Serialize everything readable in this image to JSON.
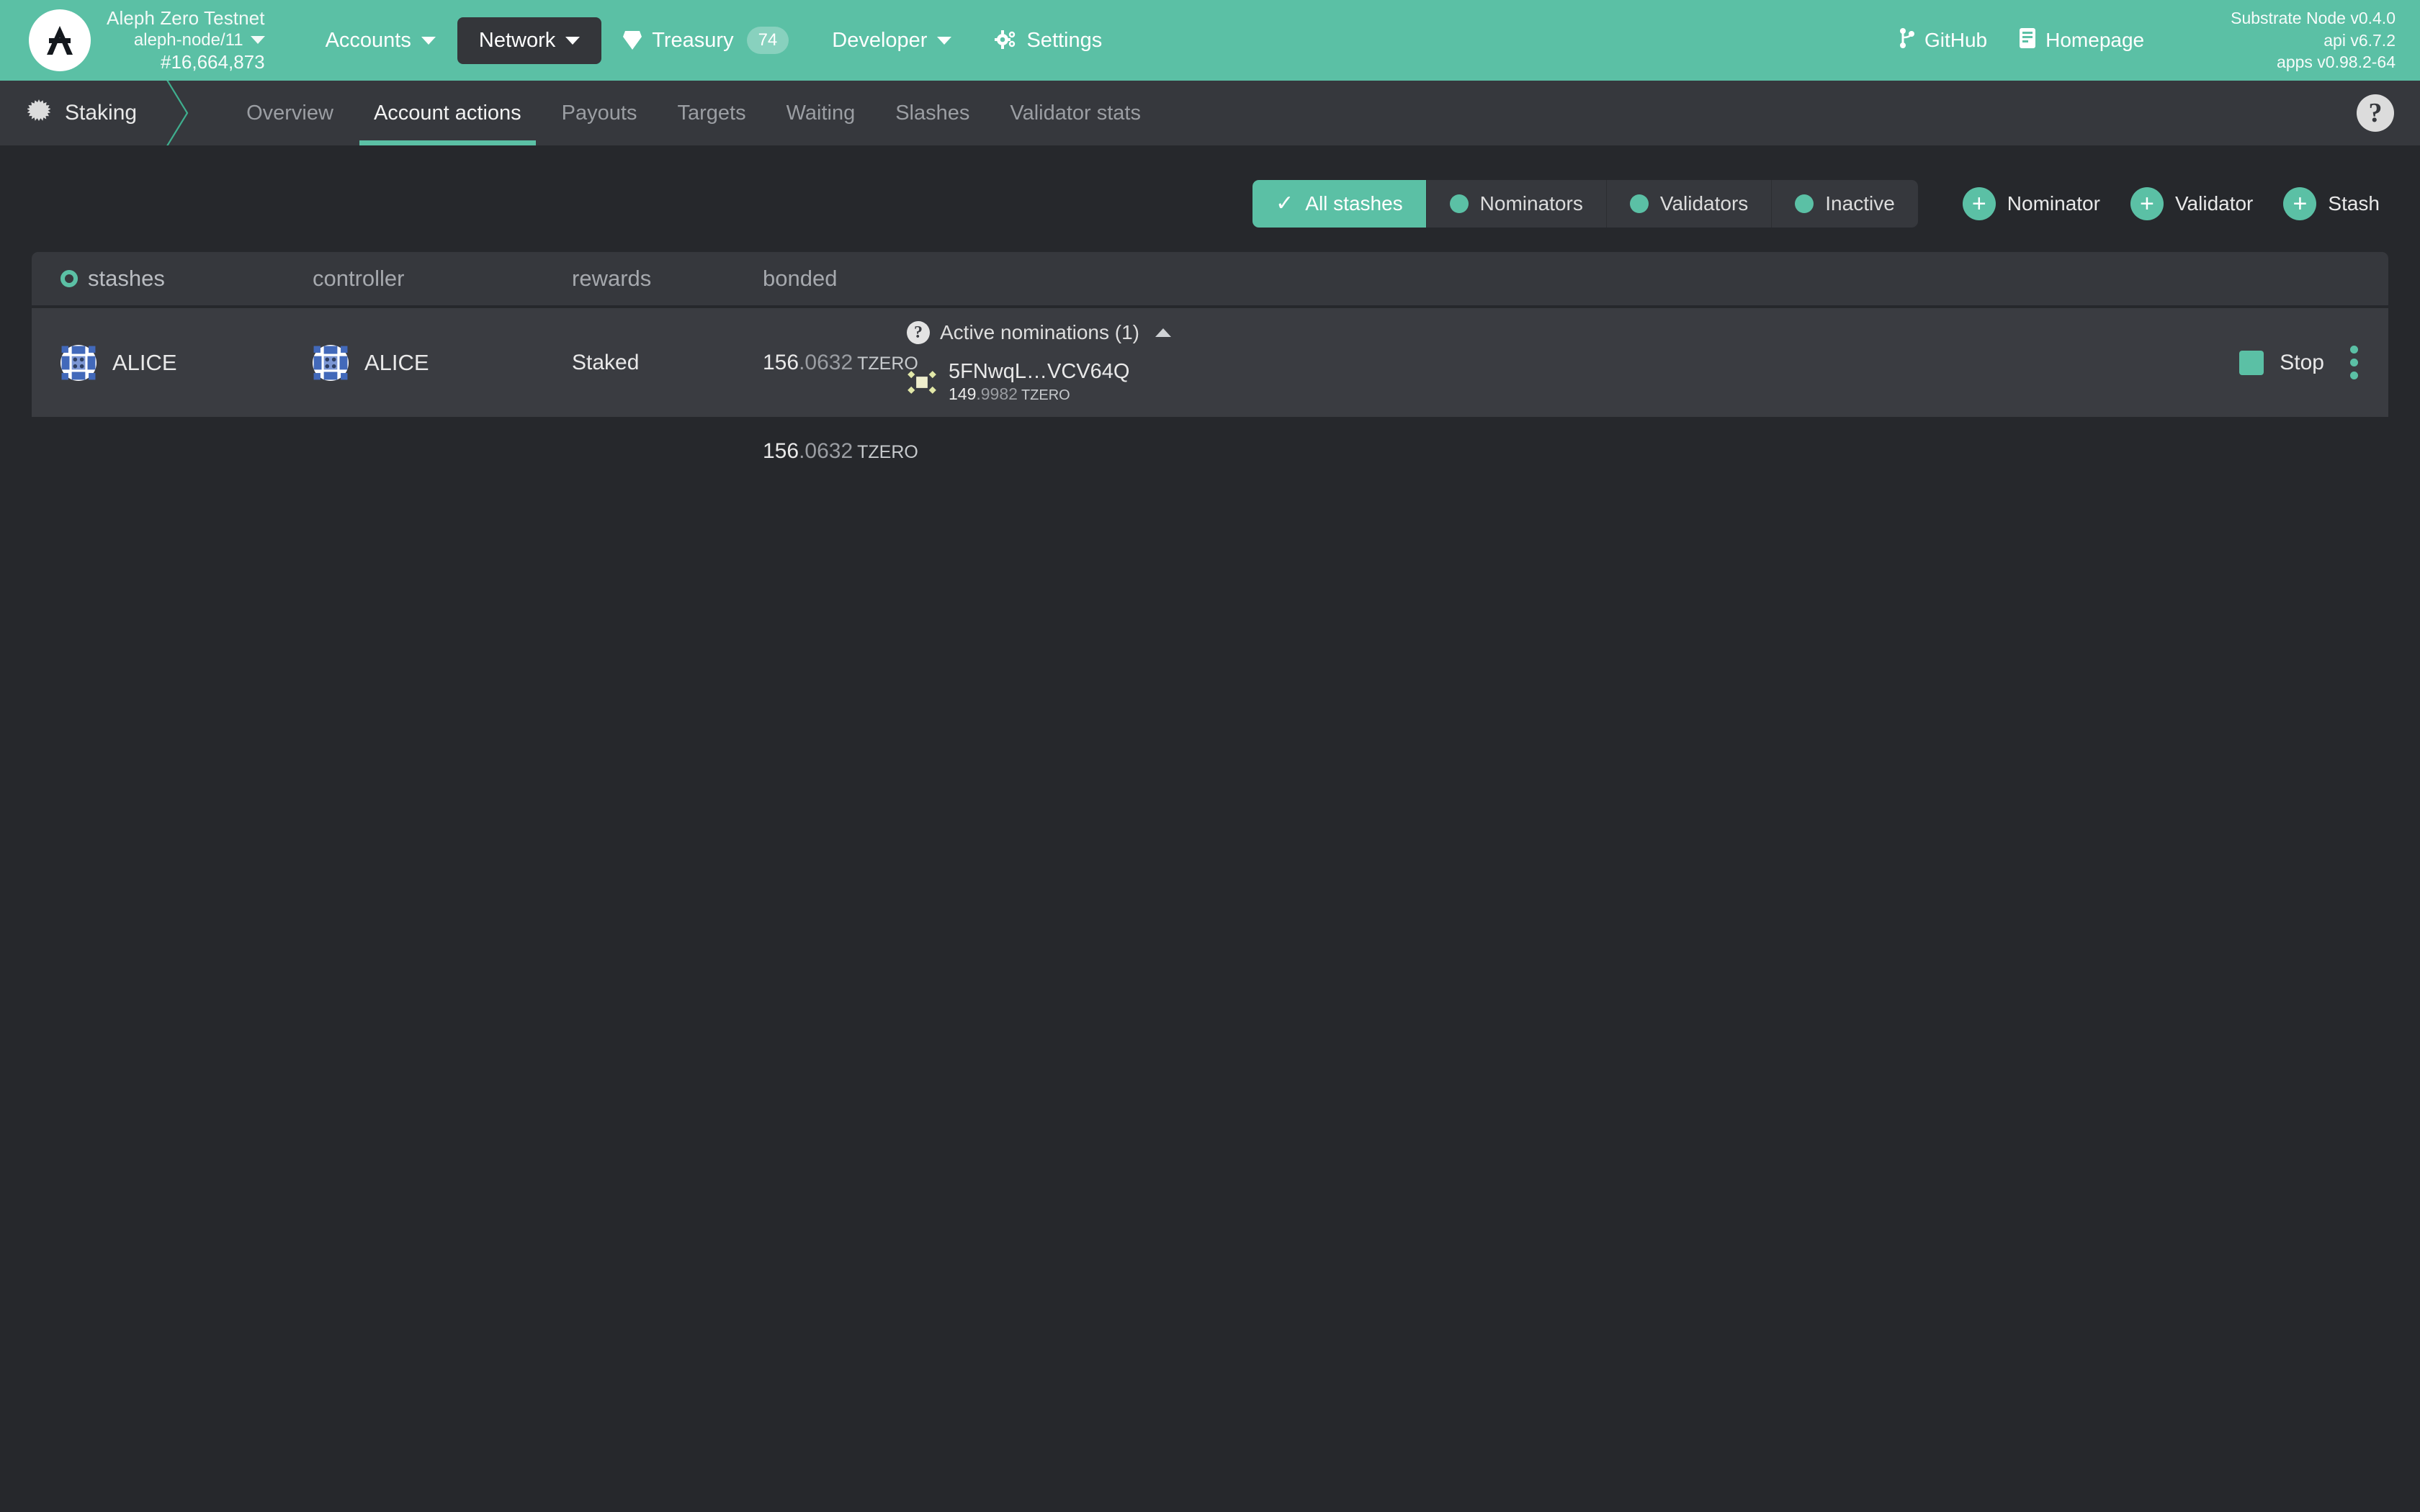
{
  "colors": {
    "brand_green": "#5bc0a5",
    "page_bg": "#26282c",
    "panel_bg": "#36383d",
    "row_bg": "#3a3c41",
    "text_primary": "#e9e9e9",
    "text_muted": "#9b9ea3"
  },
  "topbar": {
    "logo_icon": "aleph-zero-logo-icon",
    "chain_name": "Aleph Zero Testnet",
    "node_name": "aleph-node/11",
    "block_number": "#16,664,873",
    "nav": [
      {
        "label": "Accounts",
        "icon": "chevron-down-icon",
        "has_caret": true,
        "active": false
      },
      {
        "label": "Network",
        "icon": "chevron-down-icon",
        "has_caret": true,
        "active": true
      },
      {
        "label": "Treasury",
        "icon": "diamond-icon",
        "badge": "74",
        "has_caret": false,
        "active": false
      },
      {
        "label": "Developer",
        "icon": "chevron-down-icon",
        "has_caret": true,
        "active": false
      },
      {
        "label": "Settings",
        "icon": "gears-icon",
        "has_caret": false,
        "active": false
      }
    ],
    "external_links": [
      {
        "label": "GitHub",
        "icon": "github-branch-icon"
      },
      {
        "label": "Homepage",
        "icon": "server-icon"
      }
    ],
    "versions": {
      "node": "Substrate Node v0.4.0",
      "api": "api v6.7.2",
      "apps": "apps v0.98.2-64"
    }
  },
  "tabbar": {
    "breadcrumb": {
      "label": "Staking",
      "icon": "staking-burst-icon"
    },
    "tabs": [
      {
        "label": "Overview",
        "active": false
      },
      {
        "label": "Account actions",
        "active": true
      },
      {
        "label": "Payouts",
        "active": false
      },
      {
        "label": "Targets",
        "active": false
      },
      {
        "label": "Waiting",
        "active": false
      },
      {
        "label": "Slashes",
        "active": false
      },
      {
        "label": "Validator stats",
        "active": false
      }
    ],
    "help_label": "?"
  },
  "filters": {
    "segments": [
      {
        "label": "All stashes",
        "active": true,
        "icon": "check-icon"
      },
      {
        "label": "Nominators",
        "active": false,
        "icon": "dot-icon"
      },
      {
        "label": "Validators",
        "active": false,
        "icon": "dot-icon"
      },
      {
        "label": "Inactive",
        "active": false,
        "icon": "dot-icon"
      }
    ],
    "add_buttons": [
      {
        "label": "Nominator",
        "icon": "plus-icon"
      },
      {
        "label": "Validator",
        "icon": "plus-icon"
      },
      {
        "label": "Stash",
        "icon": "plus-icon"
      }
    ]
  },
  "table": {
    "columns": [
      {
        "key": "stashes",
        "label": "stashes",
        "icon": "sort-ring-icon"
      },
      {
        "key": "controller",
        "label": "controller"
      },
      {
        "key": "rewards",
        "label": "rewards"
      },
      {
        "key": "bonded",
        "label": "bonded"
      }
    ],
    "rows": [
      {
        "stash": {
          "name": "ALICE",
          "identicon": "identicon-blue"
        },
        "controller": {
          "name": "ALICE",
          "identicon": "identicon-blue"
        },
        "rewards": "Staked",
        "bonded": {
          "whole": "156",
          "decimals": ".0632",
          "unit": "TZERO"
        },
        "nominations": {
          "header": "Active nominations (1)",
          "help_icon": "question-mark-icon",
          "toggle_icon": "triangle-up-icon",
          "items": [
            {
              "address": "5FNwqL…VCV64Q",
              "identicon": "identicon-yellow",
              "amount": {
                "whole": "149",
                "decimals": ".9982",
                "unit": "TZERO"
              }
            }
          ]
        },
        "actions": {
          "stop_label": "Stop",
          "stop_icon": "stop-square-icon",
          "menu_icon": "kebab-menu-icon"
        }
      }
    ],
    "footer_total": {
      "whole": "156",
      "decimals": ".0632",
      "unit": "TZERO"
    }
  }
}
